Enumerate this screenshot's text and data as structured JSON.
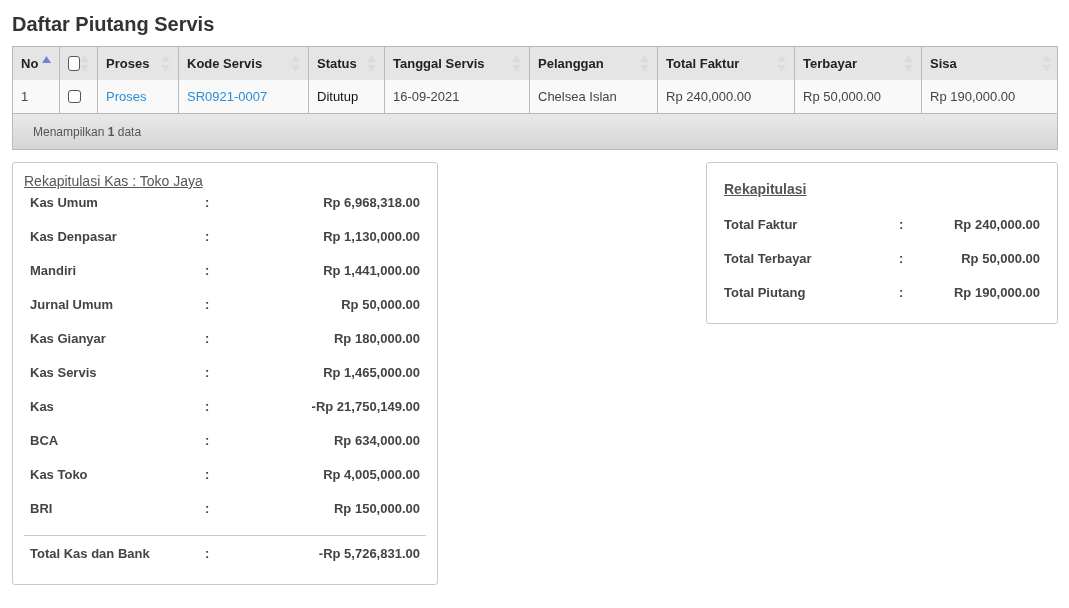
{
  "page_title": "Daftar Piutang Servis",
  "table": {
    "columns": [
      {
        "label": "No",
        "kind": "text",
        "sorted": true
      },
      {
        "kind": "checkbox",
        "checked": false,
        "sorted": false
      },
      {
        "label": "Proses",
        "kind": "text",
        "sorted": false
      },
      {
        "label": "Kode Servis",
        "kind": "text",
        "sorted": false
      },
      {
        "label": "Status",
        "kind": "text",
        "sorted": false
      },
      {
        "label": "Tanggal Servis",
        "kind": "text",
        "sorted": false
      },
      {
        "label": "Pelanggan",
        "kind": "text",
        "sorted": false
      },
      {
        "label": "Total Faktur",
        "kind": "text",
        "sorted": false
      },
      {
        "label": "Terbayar",
        "kind": "text",
        "sorted": false
      },
      {
        "label": "Sisa",
        "kind": "text",
        "sorted": false
      }
    ],
    "rows": [
      {
        "cells": [
          {
            "kind": "text",
            "text": "1"
          },
          {
            "kind": "checkbox",
            "checked": false
          },
          {
            "kind": "link",
            "text": "Proses"
          },
          {
            "kind": "link",
            "text": "SR0921-0007"
          },
          {
            "kind": "strong",
            "text": "Ditutup"
          },
          {
            "kind": "text",
            "text": "16-09-2021"
          },
          {
            "kind": "text",
            "text": "Chelsea Islan"
          },
          {
            "kind": "text",
            "text": "Rp 240,000.00"
          },
          {
            "kind": "text",
            "text": "Rp 50,000.00"
          },
          {
            "kind": "text",
            "text": "Rp 190,000.00"
          }
        ]
      }
    ],
    "footer": "Menampilkan **1** data"
  },
  "kas": {
    "title": "Rekapitulasi Kas : Toko Jaya",
    "rows": [
      {
        "label": "Kas Umum",
        "separator": ":",
        "value": "Rp 6,968,318.00"
      },
      {
        "label": "Kas Denpasar",
        "separator": ":",
        "value": "Rp 1,130,000.00"
      },
      {
        "label": "Mandiri",
        "separator": ":",
        "value": "Rp 1,441,000.00"
      },
      {
        "label": "Jurnal Umum",
        "separator": ":",
        "value": "Rp 50,000.00"
      },
      {
        "label": "Kas Gianyar",
        "separator": ":",
        "value": "Rp 180,000.00"
      },
      {
        "label": "Kas Servis",
        "separator": ":",
        "value": "Rp 1,465,000.00"
      },
      {
        "label": "Kas",
        "separator": ":",
        "value": "-Rp 21,750,149.00"
      },
      {
        "label": "BCA",
        "separator": ":",
        "value": "Rp 634,000.00"
      },
      {
        "label": "Kas Toko",
        "separator": ":",
        "value": "Rp 4,005,000.00"
      },
      {
        "label": "BRI",
        "separator": ":",
        "value": "Rp 150,000.00"
      }
    ],
    "total": {
      "label": "Total Kas dan Bank",
      "separator": ":",
      "value": "-Rp 5,726,831.00"
    }
  },
  "rekap": {
    "title": "Rekapitulasi",
    "rows": [
      {
        "label": "Total Faktur",
        "separator": ":",
        "value": "Rp 240,000.00"
      },
      {
        "label": "Total Terbayar",
        "separator": ":",
        "value": "Rp 50,000.00"
      },
      {
        "label": "Total Piutang",
        "separator": ":",
        "value": "Rp 190,000.00"
      }
    ]
  }
}
